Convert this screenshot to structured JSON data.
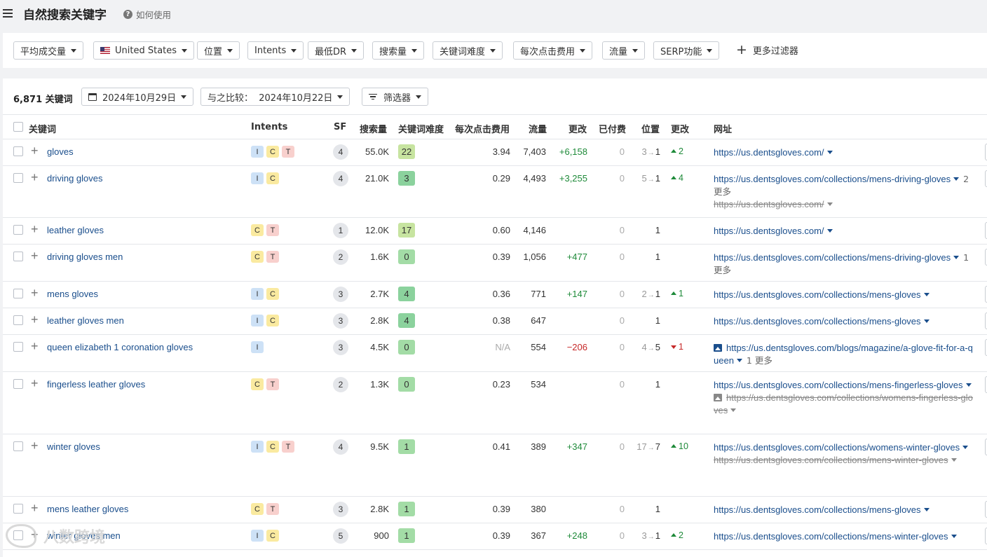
{
  "header": {
    "title": "自然搜索关键字",
    "help": "如何使用"
  },
  "filters": {
    "items": [
      {
        "label": "平均成交量"
      },
      {
        "label": "United States",
        "flag": true
      },
      {
        "label": "位置"
      },
      {
        "label": "Intents"
      },
      {
        "label": "最低DR"
      },
      {
        "label": "搜索量"
      },
      {
        "label": "关键词难度"
      },
      {
        "label": "每次点击费用"
      },
      {
        "label": "流量"
      },
      {
        "label": "SERP功能"
      }
    ],
    "more": "更多过滤器"
  },
  "toolbar": {
    "count": "6,871 关键词",
    "date": "2024年10月29日",
    "compare": "与之比较：  2024年10月22日",
    "filter_btn": "筛选器"
  },
  "columns": {
    "keyword": "关键词",
    "intents": "Intents",
    "sf": "SF",
    "volume": "搜索量",
    "kd": "关键词难度",
    "cpc": "每次点击费用",
    "traffic": "流量",
    "change": "更改",
    "paid": "已付费",
    "position": "位置",
    "pos_change": "更改",
    "url": "网址"
  },
  "rows": [
    {
      "keyword": "gloves",
      "intents": [
        "I",
        "C",
        "T"
      ],
      "sf": "4",
      "volume": "55.0K",
      "kd": "22",
      "cpc": "3.94",
      "traffic": "7,403",
      "change": "+6,158",
      "paid": "0",
      "pos_old": "3",
      "pos_new": "1",
      "pos_change": "2",
      "url": "https://us.dentsgloves.com/"
    },
    {
      "keyword": "driving gloves",
      "intents": [
        "I",
        "C"
      ],
      "sf": "4",
      "volume": "21.0K",
      "kd": "3",
      "cpc": "0.29",
      "traffic": "4,493",
      "change": "+3,255",
      "paid": "0",
      "pos_old": "5",
      "pos_new": "1",
      "pos_change": "4",
      "url": "https://us.dentsgloves.com/collections/mens-driving-gloves",
      "more": "2 更多",
      "sub_url": "https://us.dentsgloves.com/"
    },
    {
      "keyword": "leather gloves",
      "intents": [
        "C",
        "T"
      ],
      "sf": "1",
      "volume": "12.0K",
      "kd": "17",
      "cpc": "0.60",
      "traffic": "4,146",
      "change": "",
      "paid": "0",
      "pos_new": "1",
      "url": "https://us.dentsgloves.com/"
    },
    {
      "keyword": "driving gloves men",
      "intents": [
        "C",
        "T"
      ],
      "sf": "2",
      "volume": "1.6K",
      "kd": "0",
      "cpc": "0.39",
      "traffic": "1,056",
      "change": "+477",
      "paid": "0",
      "pos_new": "1",
      "url": "https://us.dentsgloves.com/collections/mens-driving-gloves",
      "more": "1 更多"
    },
    {
      "keyword": "mens gloves",
      "intents": [
        "I",
        "C"
      ],
      "sf": "3",
      "volume": "2.7K",
      "kd": "4",
      "cpc": "0.36",
      "traffic": "771",
      "change": "+147",
      "paid": "0",
      "pos_old": "2",
      "pos_new": "1",
      "pos_change": "1",
      "url": "https://us.dentsgloves.com/collections/mens-gloves"
    },
    {
      "keyword": "leather gloves men",
      "intents": [
        "I",
        "C"
      ],
      "sf": "3",
      "volume": "2.8K",
      "kd": "4",
      "cpc": "0.38",
      "traffic": "647",
      "change": "",
      "paid": "0",
      "pos_new": "1",
      "url": "https://us.dentsgloves.com/collections/mens-gloves"
    },
    {
      "keyword": "queen elizabeth 1 coronation gloves",
      "intents": [
        "I"
      ],
      "sf": "3",
      "volume": "4.5K",
      "kd": "0",
      "cpc": "N/A",
      "traffic": "554",
      "change": "−206",
      "paid": "0",
      "pos_old": "4",
      "pos_new": "5",
      "pos_change": "1",
      "url": "https://us.dentsgloves.com/blogs/magazine/a-glove-fit-for-a-queen",
      "more": "1 更多"
    },
    {
      "keyword": "fingerless leather gloves",
      "intents": [
        "C",
        "T"
      ],
      "sf": "2",
      "volume": "1.3K",
      "kd": "0",
      "cpc": "0.23",
      "traffic": "534",
      "change": "",
      "paid": "0",
      "pos_new": "1",
      "url": "https://us.dentsgloves.com/collections/mens-fingerless-gloves",
      "sub_url": "https://us.dentsgloves.com/collections/womens-fingerless-gloves"
    },
    {
      "keyword": "winter gloves",
      "intents": [
        "I",
        "C",
        "T"
      ],
      "sf": "4",
      "volume": "9.5K",
      "kd": "1",
      "cpc": "0.41",
      "traffic": "389",
      "change": "+347",
      "paid": "0",
      "pos_old": "17",
      "pos_new": "7",
      "pos_change": "10",
      "url": "https://us.dentsgloves.com/collections/womens-winter-gloves",
      "sub_url": "https://us.dentsgloves.com/collections/mens-winter-gloves"
    },
    {
      "keyword": "mens leather gloves",
      "intents": [
        "C",
        "T"
      ],
      "sf": "3",
      "volume": "2.8K",
      "kd": "1",
      "cpc": "0.39",
      "traffic": "380",
      "change": "",
      "paid": "0",
      "pos_new": "1",
      "url": "https://us.dentsgloves.com/collections/mens-gloves"
    },
    {
      "keyword": "winter gloves men",
      "intents": [
        "I",
        "C"
      ],
      "sf": "5",
      "volume": "900",
      "kd": "1",
      "cpc": "0.39",
      "traffic": "367",
      "change": "+248",
      "paid": "0",
      "pos_old": "3",
      "pos_new": "1",
      "pos_change": "2",
      "url": "https://us.dentsgloves.com/collections/mens-winter-gloves"
    }
  ],
  "watermark": "八数跨境"
}
